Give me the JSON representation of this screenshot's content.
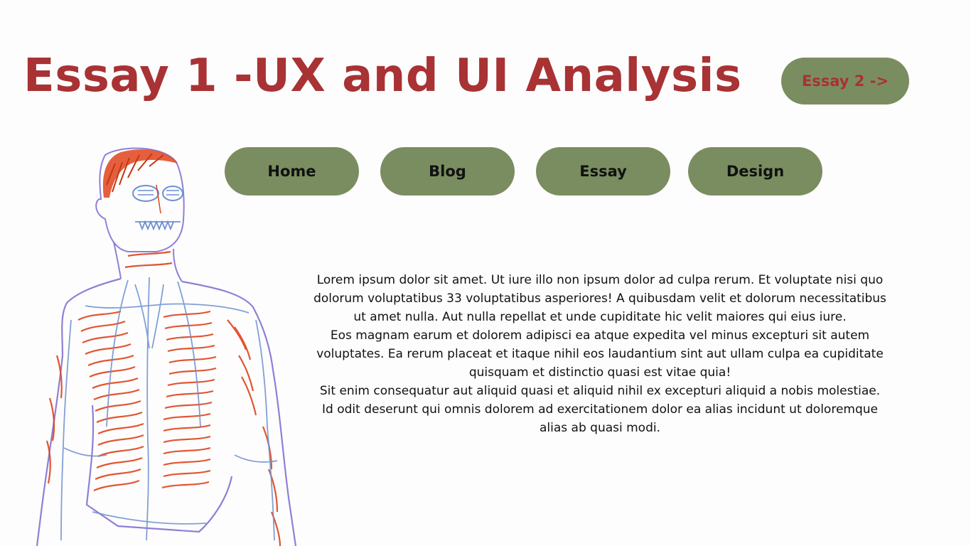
{
  "header": {
    "title": "Essay 1 -UX and UI Analysis",
    "next_button_label": "Essay 2 ->"
  },
  "nav": {
    "items": [
      {
        "label": "Home"
      },
      {
        "label": "Blog"
      },
      {
        "label": "Essay"
      },
      {
        "label": "Design"
      }
    ]
  },
  "content": {
    "paragraphs": [
      "Lorem ipsum dolor sit amet. Ut iure illo non ipsum dolor ad culpa rerum. Et voluptate nisi quo dolorum voluptatibus 33 voluptatibus asperiores! A quibusdam velit et dolorum necessitatibus ut amet nulla. Aut nulla repellat et unde cupiditate hic velit maiores qui eius iure.",
      "Eos magnam earum et dolorem adipisci ea atque expedita vel minus excepturi sit autem voluptates. Ea rerum placeat et itaque nihil eos laudantium sint aut ullam culpa ea cupiditate quisquam et distinctio quasi est vitae quia!",
      "Sit enim consequatur aut aliquid quasi et aliquid nihil ex excepturi aliquid a nobis molestiae. Id odit deserunt qui omnis dolorem ad exercitationem dolor ea alias incidunt ut doloremque alias ab quasi modi."
    ]
  },
  "colors": {
    "background": "#fdfdfd",
    "title_red": "#a83234",
    "pill_green": "#7a8d61",
    "sketch_red": "#e0431c",
    "sketch_blue": "#6d8fd0",
    "sketch_purple": "#8f7fd6"
  },
  "illustration": {
    "icon": "anatomical-sketch"
  }
}
